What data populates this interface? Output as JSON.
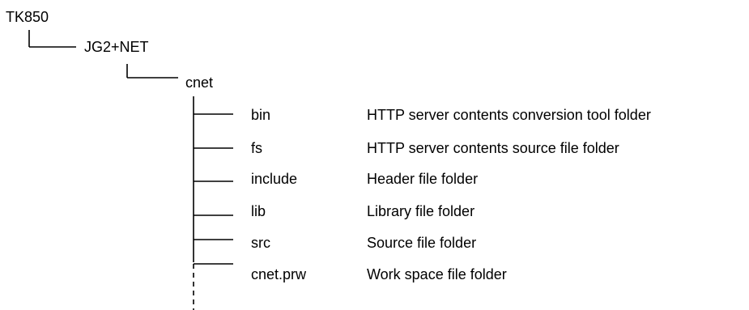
{
  "tree": {
    "root": "TK850",
    "level1": "JG2+NET",
    "level2": "cnet",
    "children": [
      {
        "name": "bin",
        "description": "HTTP server contents conversion tool folder"
      },
      {
        "name": "fs",
        "description": "HTTP server contents source file folder"
      },
      {
        "name": "include",
        "description": "Header file folder"
      },
      {
        "name": "lib",
        "description": "Library file folder"
      },
      {
        "name": "src",
        "description": "Source file folder"
      },
      {
        "name": "cnet.prw",
        "description": "Work space file folder"
      }
    ]
  }
}
